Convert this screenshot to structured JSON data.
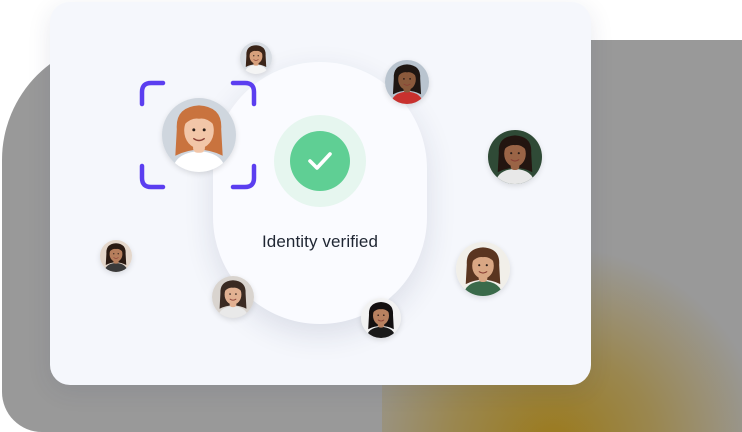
{
  "verification": {
    "status_text": "Identity verified",
    "status_icon": "checkmark-icon"
  },
  "colors": {
    "accent_purple": "#5b3ef0",
    "success_green": "#5fcf94",
    "success_halo": "#e6f6ef",
    "card_background": "#f5f7fc",
    "backdrop_gray": "#999999",
    "backdrop_glow": "#9b7814"
  },
  "avatars": [
    {
      "id": "primary-face",
      "skin": "#f2c6a8",
      "hair": "#c9733e",
      "bg": "#cfd6de",
      "top": "#ffffff"
    },
    {
      "id": "woman-top",
      "skin": "#d7a07c",
      "hair": "#3a2418",
      "bg": "#d8dde3",
      "top": "#f4f4f4"
    },
    {
      "id": "man-top-right",
      "skin": "#8a5a3c",
      "hair": "#1e1612",
      "bg": "#b9c4cf",
      "top": "#c8312e"
    },
    {
      "id": "woman-right",
      "skin": "#9a6446",
      "hair": "#231510",
      "bg": "#2f4a36",
      "top": "#e8e8e8"
    },
    {
      "id": "woman-left",
      "skin": "#b67e5c",
      "hair": "#2a1a12",
      "bg": "#e4d7cb",
      "top": "#3a3a3a"
    },
    {
      "id": "man-bottom",
      "skin": "#e2b192",
      "hair": "#3a2a22",
      "bg": "#d9d4cf",
      "top": "#e9e9e9"
    },
    {
      "id": "woman-bottom",
      "skin": "#b88160",
      "hair": "#141010",
      "bg": "#f2f2f2",
      "top": "#1a1a1a"
    },
    {
      "id": "woman-curly-right",
      "skin": "#d9a784",
      "hair": "#5a3520",
      "bg": "#f1efe9",
      "top": "#3a6a4a"
    }
  ]
}
